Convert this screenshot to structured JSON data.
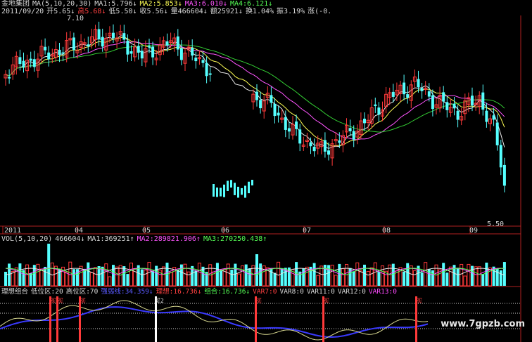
{
  "main_header": {
    "name": "金地集团",
    "ma_label": "MA(5,10,20,30)",
    "ma1": "MA1:5.796↓",
    "ma2": "MA2:5.853↓",
    "ma3": "MA3:6.010↓",
    "ma4": "MA4:6.121↓"
  },
  "quote_line": {
    "date": "2011/09/20",
    "open": "开5.65↓",
    "high": "高5.68↓",
    "low": "低5.50↓",
    "close": "收5.56↓",
    "volume": "量466604↓",
    "amount": "额25921↓",
    "turnover": "换1.04%",
    "amplitude": "振3.19%",
    "change": "涨(-0."
  },
  "price_labels": {
    "high_marker": "7.10",
    "low_marker": "5.50"
  },
  "time_axis": [
    "2011",
    "04",
    "05",
    "06",
    "07",
    "08",
    "09"
  ],
  "vol_header": {
    "label": "VOL(5,10,20)",
    "value": "466604↓",
    "ma1": "MA1:369251↑",
    "ma2": "MA2:289821.906↑",
    "ma3": "MA3:270250.438↑"
  },
  "indicator_header": {
    "name": "理想组合",
    "low_zone": "低位区:20",
    "high_zone": "高位区:70",
    "blue_line": "强弱线:34.359↓",
    "ideal": "理想:16.736↓",
    "combo": "组合:16.736↓",
    "var7": "VAR7:0",
    "var8": "VAR8:0",
    "var11": "VAR11:0",
    "var12": "VAR12:0",
    "var13": "VAR13:0"
  },
  "indicator_markers": [
    "买",
    "买",
    "买",
    "买2",
    "买",
    "买",
    "买"
  ],
  "watermark": "www.7gpzb.com",
  "colors": {
    "up": "#ff3a3a",
    "down": "#55ffff",
    "ma1": "#e8e8e8",
    "ma2": "#ffff55",
    "ma3": "#ff55ff",
    "ma4": "#33cc33",
    "axis": "#b02020"
  }
}
